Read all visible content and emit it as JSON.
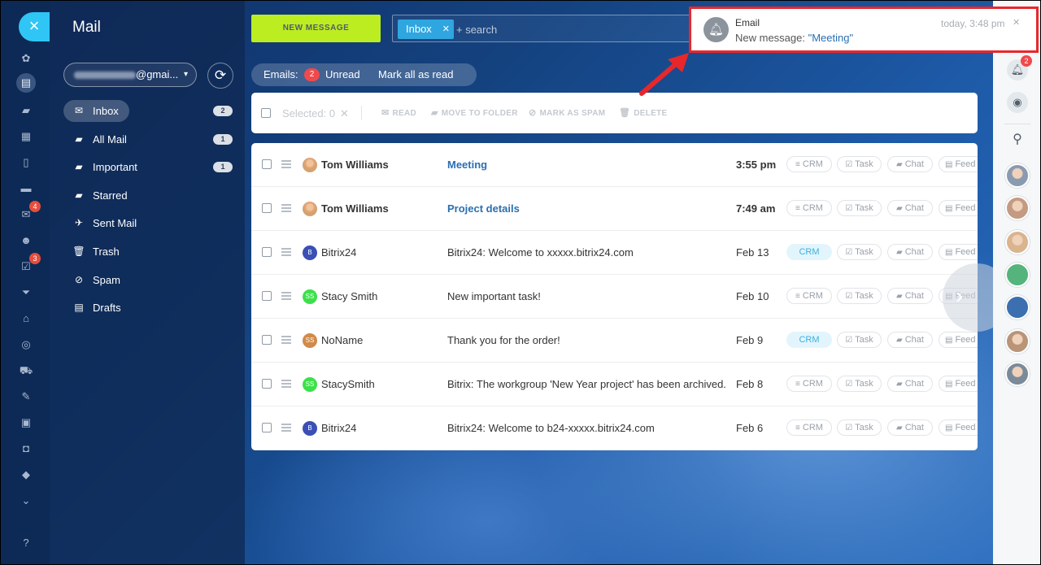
{
  "app": {
    "title": "Mail"
  },
  "left_rail": {
    "close_icon": "close-icon",
    "items": [
      {
        "icon": "stream-icon",
        "glyph": "✿"
      },
      {
        "icon": "feed-icon",
        "glyph": "▤"
      },
      {
        "icon": "chat-icon",
        "glyph": "▰"
      },
      {
        "icon": "calendar-icon",
        "glyph": "▦"
      },
      {
        "icon": "document-icon",
        "glyph": "▯"
      },
      {
        "icon": "drive-icon",
        "glyph": "▬"
      },
      {
        "icon": "mail-icon",
        "glyph": "✉",
        "badge": "4"
      },
      {
        "icon": "groups-icon",
        "glyph": "☻"
      },
      {
        "icon": "tasks-icon",
        "glyph": "☑",
        "badge": "3"
      },
      {
        "icon": "funnel-icon",
        "glyph": "⏷"
      },
      {
        "icon": "bank-icon",
        "glyph": "⌂"
      },
      {
        "icon": "target-icon",
        "glyph": "◎"
      },
      {
        "icon": "cart-icon",
        "glyph": "⛟"
      },
      {
        "icon": "sign-icon",
        "glyph": "✎"
      },
      {
        "icon": "contact-card-icon",
        "glyph": "▣"
      },
      {
        "icon": "robot-icon",
        "glyph": "◘"
      },
      {
        "icon": "box-icon",
        "glyph": "◆"
      },
      {
        "icon": "more-icon",
        "glyph": "⌄"
      },
      {
        "icon": "help-icon",
        "glyph": "?"
      }
    ]
  },
  "sidebar": {
    "account_suffix": "@gmai...",
    "folders": [
      {
        "label": "Inbox",
        "count": "2",
        "icon": "inbox-icon",
        "glyph": "✉"
      },
      {
        "label": "All Mail",
        "count": "1",
        "icon": "folder-icon",
        "glyph": "▰"
      },
      {
        "label": "Important",
        "count": "1",
        "icon": "folder-icon",
        "glyph": "▰"
      },
      {
        "label": "Starred",
        "count": "",
        "icon": "folder-icon",
        "glyph": "▰"
      },
      {
        "label": "Sent Mail",
        "count": "",
        "icon": "sent-icon",
        "glyph": "✈"
      },
      {
        "label": "Trash",
        "count": "",
        "icon": "trash-icon",
        "glyph": "🗑"
      },
      {
        "label": "Spam",
        "count": "",
        "icon": "spam-icon",
        "glyph": "⊘"
      },
      {
        "label": "Drafts",
        "count": "",
        "icon": "draft-icon",
        "glyph": "▤"
      }
    ]
  },
  "header": {
    "new_message": "NEW MESSAGE",
    "filter_chip": "Inbox",
    "search_placeholder": "+ search"
  },
  "counters": {
    "label": "Emails:",
    "unread_count": "2",
    "unread_label": "Unread",
    "mark_all": "Mark all as read"
  },
  "toolbar": {
    "selected": "Selected: 0",
    "read": "READ",
    "move": "MOVE TO FOLDER",
    "spam": "MARK AS SPAM",
    "delete": "DELETE"
  },
  "messages": [
    {
      "from": "Tom Williams",
      "subject": "Meeting",
      "date": "3:55 pm",
      "unread": true,
      "avatar": "photo",
      "initials": "",
      "avatar_color": "#d3a36f",
      "crm_on": false
    },
    {
      "from": "Tom Williams",
      "subject": "Project details",
      "date": "7:49 am",
      "unread": true,
      "avatar": "photo",
      "initials": "",
      "avatar_color": "#d3a36f",
      "crm_on": false
    },
    {
      "from": "Bitrix24",
      "subject": "Bitrix24: Welcome to xxxxx.bitrix24.com",
      "date": "Feb 13",
      "unread": false,
      "avatar": "initials",
      "initials": "B",
      "avatar_color": "#3b4fb5",
      "crm_on": true
    },
    {
      "from": "Stacy Smith",
      "subject": "New important task!",
      "date": "Feb 10",
      "unread": false,
      "avatar": "initials",
      "initials": "SS",
      "avatar_color": "#3de04a",
      "crm_on": false
    },
    {
      "from": "NoName",
      "subject": "Thank you for the order!",
      "date": "Feb 9",
      "unread": false,
      "avatar": "initials",
      "initials": "SS",
      "avatar_color": "#d08a4a",
      "crm_on": true
    },
    {
      "from": "StacySmith",
      "subject": "Bitrix: The workgroup 'New Year project' has been archived.",
      "date": "Feb 8",
      "unread": false,
      "avatar": "initials",
      "initials": "SS",
      "avatar_color": "#3de04a",
      "crm_on": false
    },
    {
      "from": "Bitrix24",
      "subject": "Bitrix24: Welcome to b24-xxxxx.bitrix24.com",
      "date": "Feb 6",
      "unread": false,
      "avatar": "initials",
      "initials": "B",
      "avatar_color": "#3b4fb5",
      "crm_on": false
    }
  ],
  "row_actions": {
    "crm": "CRM",
    "task": "Task",
    "chat": "Chat",
    "feed": "Feed"
  },
  "notification": {
    "title": "Email",
    "time": "today, 3:48 pm",
    "message_prefix": "New message: ",
    "message_subject": "\"Meeting\""
  },
  "right_panel": {
    "notifications_badge": "2",
    "avatars": [
      "#8a9bb0",
      "#c49a82",
      "#d9b48f",
      "#55b47c",
      "#3b6fb0",
      "#b89478",
      "#7a8a99"
    ]
  },
  "colors": {
    "accent_green": "#bbed21",
    "highlight_red": "#e8272b",
    "link_blue": "#2a6fb1"
  }
}
